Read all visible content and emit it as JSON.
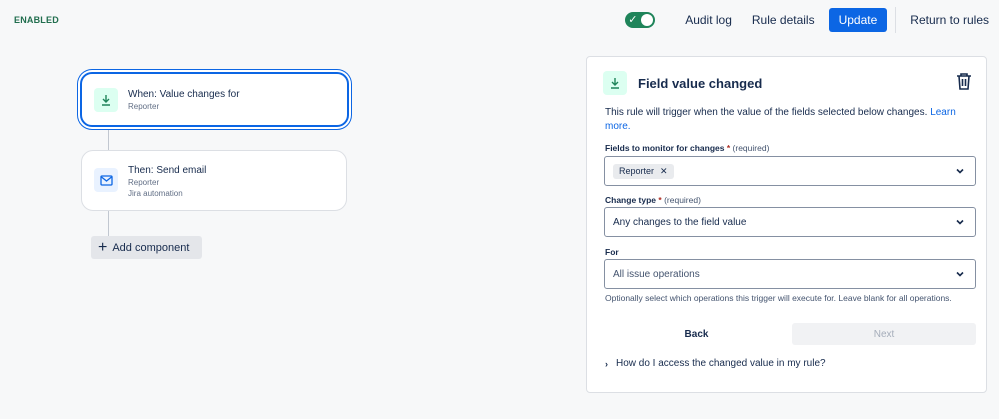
{
  "status_badge": "ENABLED",
  "topbar": {
    "toggle_on": true,
    "audit_log": "Audit log",
    "rule_details": "Rule details",
    "update": "Update",
    "return": "Return to rules"
  },
  "flow": {
    "trigger": {
      "title": "When: Value changes for",
      "sub": "Reporter",
      "icon": "field-changed-icon"
    },
    "action": {
      "title": "Then: Send email",
      "sub1": "Reporter",
      "sub2": "Jira automation",
      "icon": "email-icon"
    },
    "add_component": "Add component"
  },
  "panel": {
    "title": "Field value changed",
    "desc": "This rule will trigger when the value of the fields selected below changes.",
    "learn_more": "Learn more.",
    "fields_label": "Fields to monitor for changes",
    "required_mark": "*",
    "required_text": "(required)",
    "fields_chip": "Reporter",
    "change_label": "Change type",
    "change_value": "Any changes to the field value",
    "for_label": "For",
    "for_placeholder": "All issue operations",
    "hint": "Optionally select which operations this trigger will execute for. Leave blank for all operations.",
    "back": "Back",
    "next": "Next",
    "faq": "How do I access the changed value in my rule?"
  },
  "colors": {
    "accent": "#0c66e4",
    "enabled": "#1f845a",
    "trigger_icon_bg": "#dcfff1",
    "action_icon_bg": "#e9f2ff"
  }
}
